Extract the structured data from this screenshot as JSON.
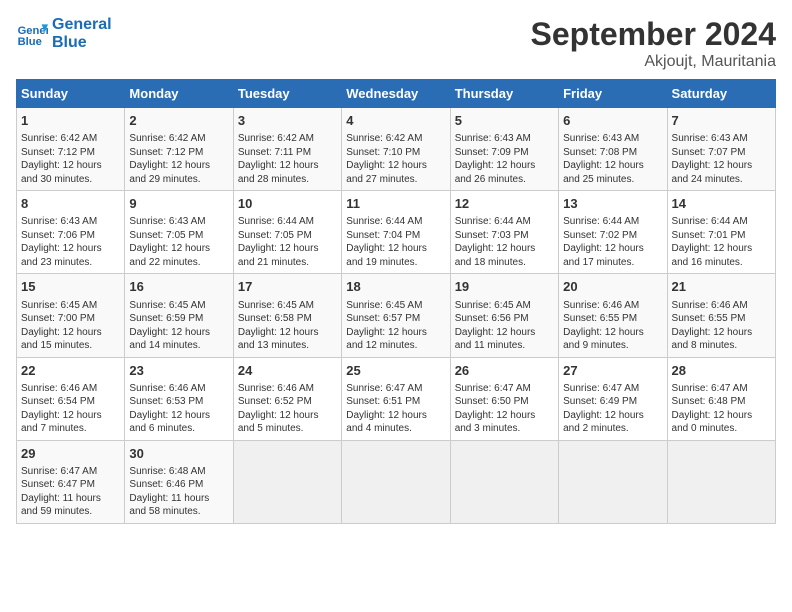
{
  "header": {
    "logo_line1": "General",
    "logo_line2": "Blue",
    "month": "September 2024",
    "location": "Akjoujt, Mauritania"
  },
  "columns": [
    "Sunday",
    "Monday",
    "Tuesday",
    "Wednesday",
    "Thursday",
    "Friday",
    "Saturday"
  ],
  "rows": [
    [
      {
        "day": "1",
        "info": "Sunrise: 6:42 AM\nSunset: 7:12 PM\nDaylight: 12 hours\nand 30 minutes."
      },
      {
        "day": "2",
        "info": "Sunrise: 6:42 AM\nSunset: 7:12 PM\nDaylight: 12 hours\nand 29 minutes."
      },
      {
        "day": "3",
        "info": "Sunrise: 6:42 AM\nSunset: 7:11 PM\nDaylight: 12 hours\nand 28 minutes."
      },
      {
        "day": "4",
        "info": "Sunrise: 6:42 AM\nSunset: 7:10 PM\nDaylight: 12 hours\nand 27 minutes."
      },
      {
        "day": "5",
        "info": "Sunrise: 6:43 AM\nSunset: 7:09 PM\nDaylight: 12 hours\nand 26 minutes."
      },
      {
        "day": "6",
        "info": "Sunrise: 6:43 AM\nSunset: 7:08 PM\nDaylight: 12 hours\nand 25 minutes."
      },
      {
        "day": "7",
        "info": "Sunrise: 6:43 AM\nSunset: 7:07 PM\nDaylight: 12 hours\nand 24 minutes."
      }
    ],
    [
      {
        "day": "8",
        "info": "Sunrise: 6:43 AM\nSunset: 7:06 PM\nDaylight: 12 hours\nand 23 minutes."
      },
      {
        "day": "9",
        "info": "Sunrise: 6:43 AM\nSunset: 7:05 PM\nDaylight: 12 hours\nand 22 minutes."
      },
      {
        "day": "10",
        "info": "Sunrise: 6:44 AM\nSunset: 7:05 PM\nDaylight: 12 hours\nand 21 minutes."
      },
      {
        "day": "11",
        "info": "Sunrise: 6:44 AM\nSunset: 7:04 PM\nDaylight: 12 hours\nand 19 minutes."
      },
      {
        "day": "12",
        "info": "Sunrise: 6:44 AM\nSunset: 7:03 PM\nDaylight: 12 hours\nand 18 minutes."
      },
      {
        "day": "13",
        "info": "Sunrise: 6:44 AM\nSunset: 7:02 PM\nDaylight: 12 hours\nand 17 minutes."
      },
      {
        "day": "14",
        "info": "Sunrise: 6:44 AM\nSunset: 7:01 PM\nDaylight: 12 hours\nand 16 minutes."
      }
    ],
    [
      {
        "day": "15",
        "info": "Sunrise: 6:45 AM\nSunset: 7:00 PM\nDaylight: 12 hours\nand 15 minutes."
      },
      {
        "day": "16",
        "info": "Sunrise: 6:45 AM\nSunset: 6:59 PM\nDaylight: 12 hours\nand 14 minutes."
      },
      {
        "day": "17",
        "info": "Sunrise: 6:45 AM\nSunset: 6:58 PM\nDaylight: 12 hours\nand 13 minutes."
      },
      {
        "day": "18",
        "info": "Sunrise: 6:45 AM\nSunset: 6:57 PM\nDaylight: 12 hours\nand 12 minutes."
      },
      {
        "day": "19",
        "info": "Sunrise: 6:45 AM\nSunset: 6:56 PM\nDaylight: 12 hours\nand 11 minutes."
      },
      {
        "day": "20",
        "info": "Sunrise: 6:46 AM\nSunset: 6:55 PM\nDaylight: 12 hours\nand 9 minutes."
      },
      {
        "day": "21",
        "info": "Sunrise: 6:46 AM\nSunset: 6:55 PM\nDaylight: 12 hours\nand 8 minutes."
      }
    ],
    [
      {
        "day": "22",
        "info": "Sunrise: 6:46 AM\nSunset: 6:54 PM\nDaylight: 12 hours\nand 7 minutes."
      },
      {
        "day": "23",
        "info": "Sunrise: 6:46 AM\nSunset: 6:53 PM\nDaylight: 12 hours\nand 6 minutes."
      },
      {
        "day": "24",
        "info": "Sunrise: 6:46 AM\nSunset: 6:52 PM\nDaylight: 12 hours\nand 5 minutes."
      },
      {
        "day": "25",
        "info": "Sunrise: 6:47 AM\nSunset: 6:51 PM\nDaylight: 12 hours\nand 4 minutes."
      },
      {
        "day": "26",
        "info": "Sunrise: 6:47 AM\nSunset: 6:50 PM\nDaylight: 12 hours\nand 3 minutes."
      },
      {
        "day": "27",
        "info": "Sunrise: 6:47 AM\nSunset: 6:49 PM\nDaylight: 12 hours\nand 2 minutes."
      },
      {
        "day": "28",
        "info": "Sunrise: 6:47 AM\nSunset: 6:48 PM\nDaylight: 12 hours\nand 0 minutes."
      }
    ],
    [
      {
        "day": "29",
        "info": "Sunrise: 6:47 AM\nSunset: 6:47 PM\nDaylight: 11 hours\nand 59 minutes."
      },
      {
        "day": "30",
        "info": "Sunrise: 6:48 AM\nSunset: 6:46 PM\nDaylight: 11 hours\nand 58 minutes."
      },
      {
        "day": "",
        "info": ""
      },
      {
        "day": "",
        "info": ""
      },
      {
        "day": "",
        "info": ""
      },
      {
        "day": "",
        "info": ""
      },
      {
        "day": "",
        "info": ""
      }
    ]
  ]
}
